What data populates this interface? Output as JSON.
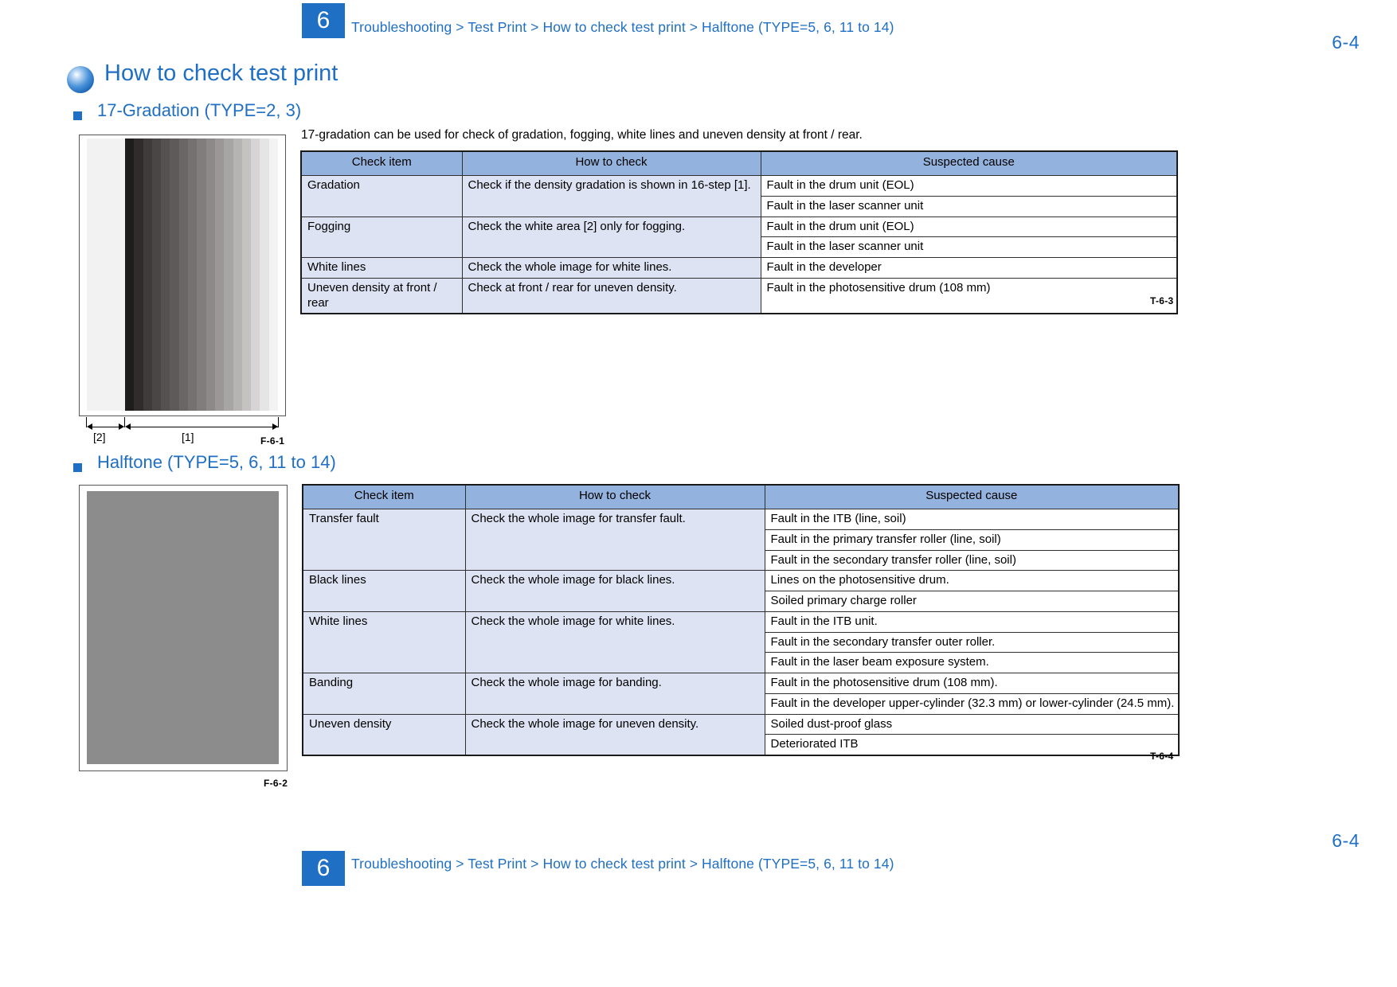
{
  "header": {
    "chapter_number": "6",
    "breadcrumb": "Troubleshooting > Test Print > How to check test print > Halftone (TYPE=5, 6, 11 to 14)",
    "page_number": "6-4",
    "accent_color": "#1f6fc4"
  },
  "title": {
    "text": "How to check test print",
    "bullet_icon": "blue-sphere-icon"
  },
  "sections": [
    {
      "heading": "17-Gradation (TYPE=2, 3)",
      "intro": "17-gradation can be used for check of gradation, fogging, white lines and uneven density at front / rear.",
      "figure": {
        "caption": "F-6-1",
        "callouts": [
          "[2]",
          "[1]"
        ],
        "type": "17-step-gradation-chart"
      },
      "table": {
        "caption": "T-6-3",
        "columns": [
          "Check item",
          "How to check",
          "Suspected cause"
        ],
        "rows": [
          {
            "check_item": "Gradation",
            "how_to_check": "Check if the density gradation is shown in 16-step [1].",
            "causes": [
              "Fault in the drum unit (EOL)",
              "Fault in the laser scanner unit"
            ]
          },
          {
            "check_item": "Fogging",
            "how_to_check": "Check the white area [2] only for fogging.",
            "causes": [
              "Fault in the drum unit (EOL)",
              "Fault in the laser scanner unit"
            ]
          },
          {
            "check_item": "White lines",
            "how_to_check": "Check the whole image for white lines.",
            "causes": [
              "Fault in the developer"
            ]
          },
          {
            "check_item": "Uneven density at front / rear",
            "how_to_check": "Check at front / rear for uneven density.",
            "causes": [
              "Fault in the photosensitive drum (108 mm)"
            ]
          }
        ]
      }
    },
    {
      "heading": "Halftone (TYPE=5, 6, 11 to 14)",
      "intro": "",
      "figure": {
        "caption": "F-6-2",
        "callouts": [],
        "type": "halftone-gray-page"
      },
      "table": {
        "caption": "T-6-4",
        "columns": [
          "Check item",
          "How to check",
          "Suspected cause"
        ],
        "rows": [
          {
            "check_item": "Transfer fault",
            "how_to_check": "Check the whole image for transfer fault.",
            "causes": [
              "Fault in the ITB (line, soil)",
              "Fault in the primary transfer roller (line, soil)",
              "Fault in the secondary transfer roller (line, soil)"
            ]
          },
          {
            "check_item": "Black lines",
            "how_to_check": "Check the whole image for black lines.",
            "causes": [
              "Lines on the photosensitive drum.",
              "Soiled primary charge roller"
            ]
          },
          {
            "check_item": "White lines",
            "how_to_check": "Check the whole image for white lines.",
            "causes": [
              "Fault in the ITB unit.",
              "Fault in the secondary transfer outer roller.",
              "Fault in the laser beam exposure system."
            ]
          },
          {
            "check_item": "Banding",
            "how_to_check": "Check the whole image for banding.",
            "causes": [
              "Fault in the photosensitive drum (108 mm).",
              "Fault in the developer upper-cylinder (32.3 mm) or lower-cylinder (24.5 mm)."
            ]
          },
          {
            "check_item": "Uneven density",
            "how_to_check": "Check the whole image for uneven density.",
            "causes": [
              "Soiled dust-proof glass",
              "Deteriorated ITB"
            ]
          }
        ]
      }
    }
  ],
  "footer": {
    "chapter_number": "6",
    "breadcrumb": "Troubleshooting > Test Print > How to check test print > Halftone (TYPE=5, 6, 11 to 14)",
    "page_number": "6-4"
  },
  "colors": {
    "accent_blue": "#1f6fc4",
    "table_header_blue": "#93b3de",
    "table_cell_lavender": "#dde3f3",
    "halftone_gray": "#8c8c8c"
  }
}
